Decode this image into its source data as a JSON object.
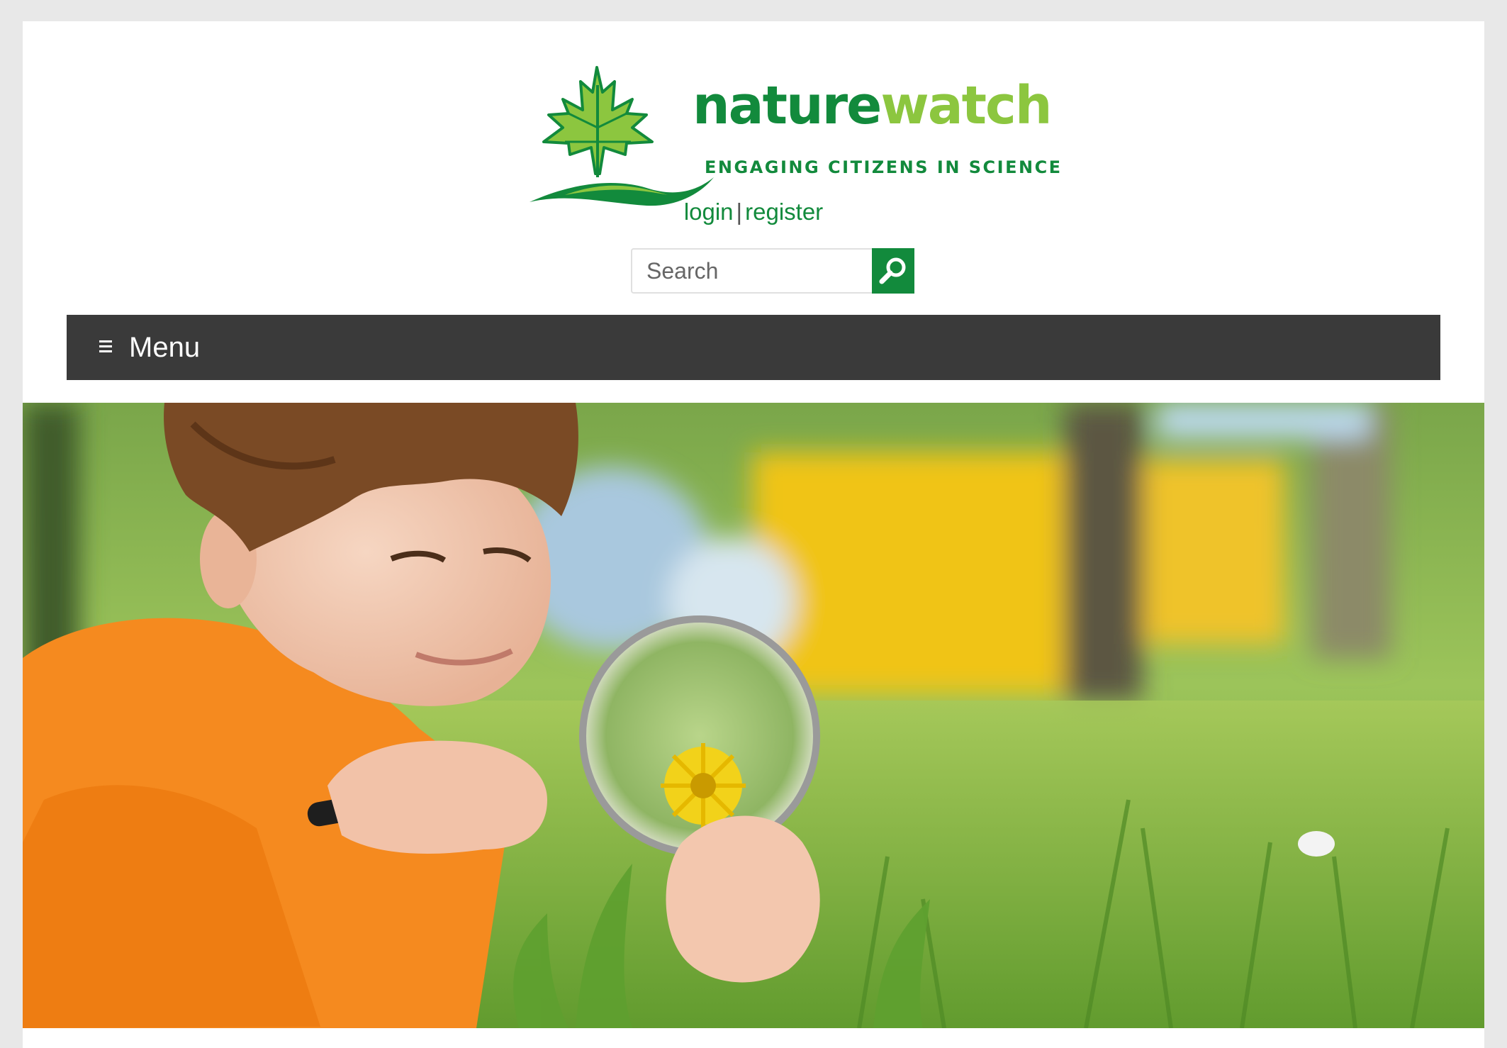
{
  "brand": {
    "wordmark_part1": "nature",
    "wordmark_part2": "watch",
    "tagline": "ENGAGING CITIZENS IN SCIENCE",
    "logo_icon": "maple-leaf-icon"
  },
  "auth": {
    "login_label": "login",
    "separator": "|",
    "register_label": "register"
  },
  "search": {
    "placeholder": "Search",
    "value": "",
    "button_icon": "magnifier-icon"
  },
  "menu": {
    "label": "Menu",
    "icon": "hamburger-icon"
  },
  "hero": {
    "image": "boy-with-magnifying-glass-photo"
  },
  "colors": {
    "brand_green": "#128a3c",
    "brand_light_green": "#8cc63f",
    "menu_bar": "#3a3a3a",
    "page_bg": "#e8e8e8"
  }
}
